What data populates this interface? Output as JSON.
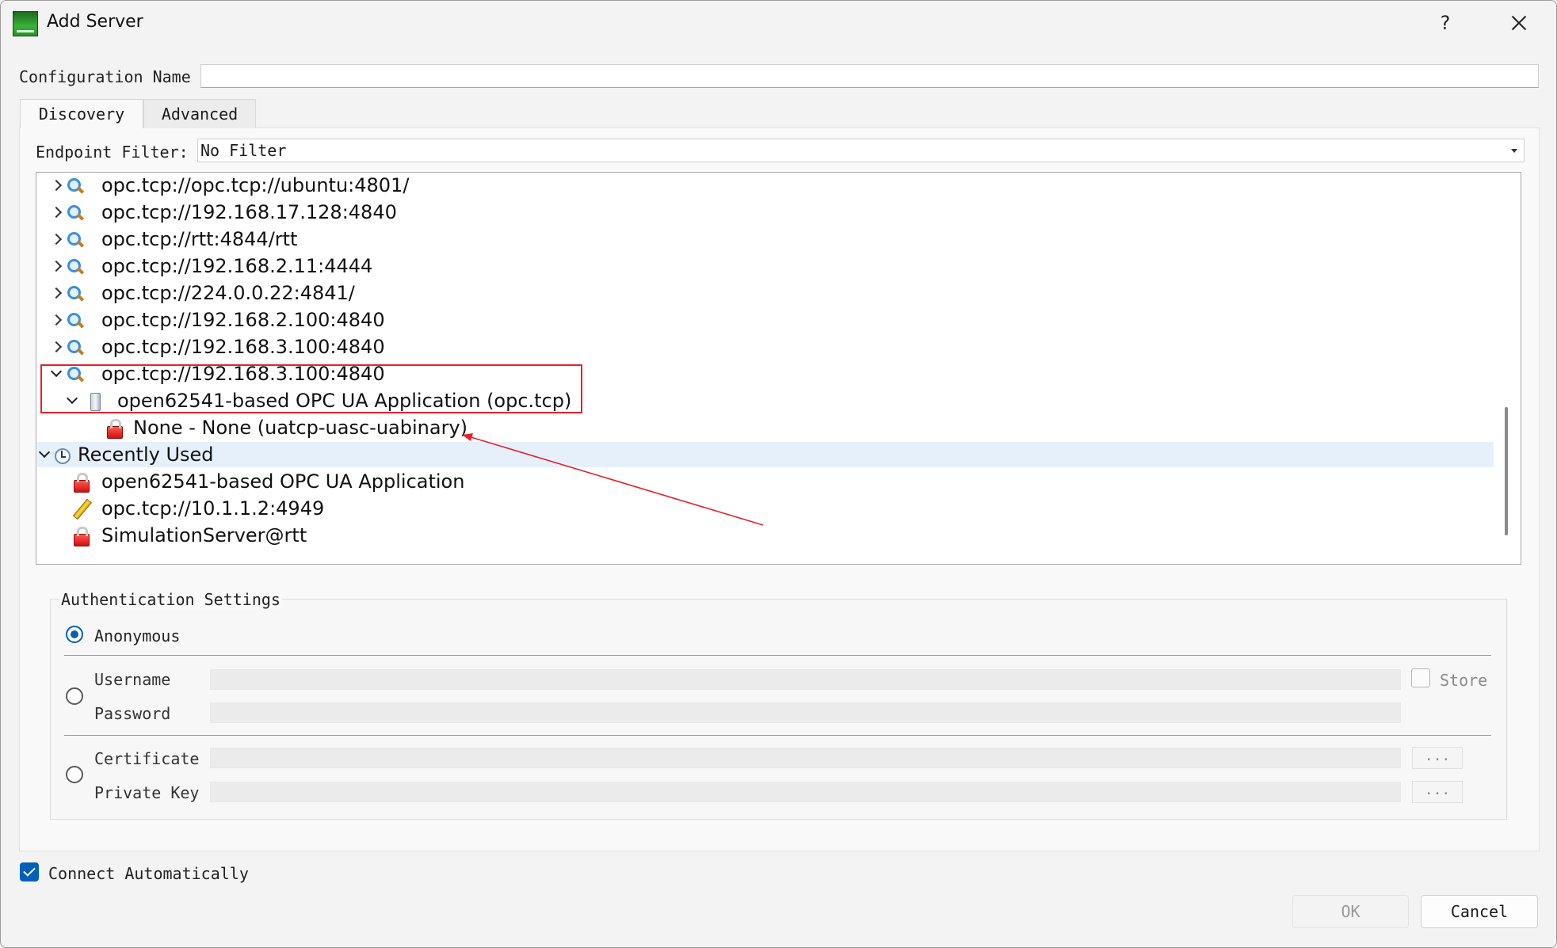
{
  "window": {
    "title": "Add Server",
    "help": "?",
    "close": "close-icon"
  },
  "config": {
    "label": "Configuration Name",
    "value": ""
  },
  "tabs": [
    {
      "label": "Discovery",
      "active": true
    },
    {
      "label": "Advanced",
      "active": false
    }
  ],
  "filter": {
    "label": "Endpoint Filter:",
    "value": "No Filter"
  },
  "tree": {
    "endpoints": [
      "opc.tcp://opc.tcp://ubuntu:4801/",
      "opc.tcp://192.168.17.128:4840",
      "opc.tcp://rtt:4844/rtt",
      "opc.tcp://192.168.2.11:4444",
      "opc.tcp://224.0.0.22:4841/",
      "opc.tcp://192.168.2.100:4840",
      "opc.tcp://192.168.3.100:4840"
    ],
    "expanded_endpoint": "opc.tcp://192.168.3.100:4840",
    "application": "open62541-based OPC UA Application (opc.tcp)",
    "security_mode": "None - None (uatcp-uasc-uabinary)",
    "recently_used": {
      "label": "Recently Used",
      "items": [
        {
          "label": "open62541-based OPC UA Application",
          "icon": "lock-icon"
        },
        {
          "label": "opc.tcp://10.1.1.2:4949",
          "icon": "pencil-icon"
        },
        {
          "label": "SimulationServer@rtt",
          "icon": "lock-icon"
        }
      ]
    }
  },
  "auth": {
    "title": "Authentication Settings",
    "anonymous_label": "Anonymous",
    "selected": "Anonymous",
    "username_label": "Username",
    "password_label": "Password",
    "store_label": "Store",
    "certificate_label": "Certificate",
    "private_key_label": "Private Key",
    "browse_label": "..."
  },
  "connect_auto": {
    "label": "Connect Automatically",
    "checked": true
  },
  "buttons": {
    "ok": "OK",
    "cancel": "Cancel"
  },
  "colors": {
    "accent": "#005fb8",
    "annotation": "#e5222a",
    "highlight_row": "#e5f0fb"
  }
}
